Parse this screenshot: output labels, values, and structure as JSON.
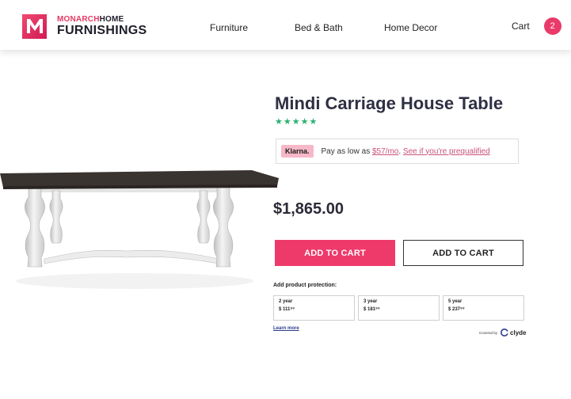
{
  "brand": {
    "line1_part1": "MONARCH",
    "line1_part2": "HOME",
    "line2": "FURNISHINGS",
    "logo_letter": "M",
    "primary_color": "#e93a6a"
  },
  "nav": {
    "items": [
      {
        "label": "Furniture"
      },
      {
        "label": "Bed & Bath"
      },
      {
        "label": "Home Decor"
      }
    ],
    "cart_label": "Cart",
    "cart_count": "2"
  },
  "product": {
    "title": "Mindi Carriage House Table",
    "rating_stars": 5,
    "star_color": "#2ab06f",
    "price": "$1,865.00"
  },
  "klarna": {
    "badge": "Klarna.",
    "text_before": "Pay as low as ",
    "amount": "$57/mo",
    "separator": ". ",
    "link": "See if you're prequalified"
  },
  "actions": {
    "add_to_cart_primary": "ADD TO CART",
    "add_to_cart_secondary": "ADD TO CART"
  },
  "protection": {
    "label": "Add product protection:",
    "plans": [
      {
        "term": "2 year",
        "price": "$ 111⁹⁹"
      },
      {
        "term": "3 year",
        "price": "$ 181⁹⁹"
      },
      {
        "term": "5 year",
        "price": "$ 237⁹⁹"
      }
    ],
    "learn_more": "Learn more",
    "covered_by": "Covered by",
    "provider": "clyde"
  }
}
